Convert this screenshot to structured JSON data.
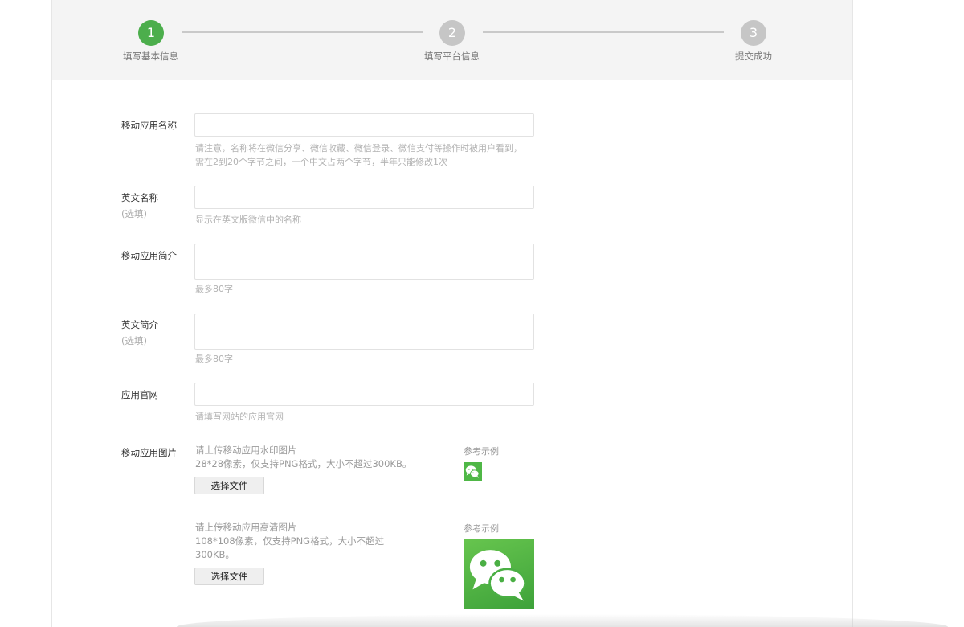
{
  "stepper": {
    "steps": [
      {
        "number": "1",
        "label": "填写基本信息",
        "state": "active"
      },
      {
        "number": "2",
        "label": "填写平台信息",
        "state": "pending"
      },
      {
        "number": "3",
        "label": "提交成功",
        "state": "pending"
      }
    ],
    "active_color": "#4cae4c",
    "inactive_color": "#c6c6c6"
  },
  "form": {
    "app_name": {
      "label": "移动应用名称",
      "value": "",
      "hint_line1": "请注意，名称将在微信分享、微信收藏、微信登录、微信支付等操作时被用户看到，",
      "hint_line2": "需在2到20个字节之间，一个中文占两个字节，半年只能修改1次"
    },
    "english_name": {
      "label": "英文名称",
      "optional": "(选填)",
      "value": "",
      "hint": "显示在英文版微信中的名称"
    },
    "app_intro": {
      "label": "移动应用简介",
      "value": "",
      "hint": "最多80字"
    },
    "english_intro": {
      "label": "英文简介",
      "optional": "(选填)",
      "value": "",
      "hint": "最多80字"
    },
    "website": {
      "label": "应用官网",
      "value": "",
      "hint": "请填写网站的应用官网"
    },
    "app_image": {
      "label": "移动应用图片",
      "watermark": {
        "title": "请上传移动应用水印图片",
        "desc": "28*28像素，仅支持PNG格式，大小不超过300KB。",
        "button": "选择文件",
        "ref_label": "参考示例",
        "ref_icon": "wechat-logo-icon"
      },
      "hd": {
        "title": "请上传移动应用高清图片",
        "desc_line1": "108*108像素，仅支持PNG格式，大小不超过",
        "desc_line2": "300KB。",
        "button": "选择文件",
        "ref_label": "参考示例",
        "ref_icon": "wechat-logo-icon"
      }
    }
  },
  "colors": {
    "brand_green": "#4cae4c",
    "wechat_green": "#4fb746"
  }
}
